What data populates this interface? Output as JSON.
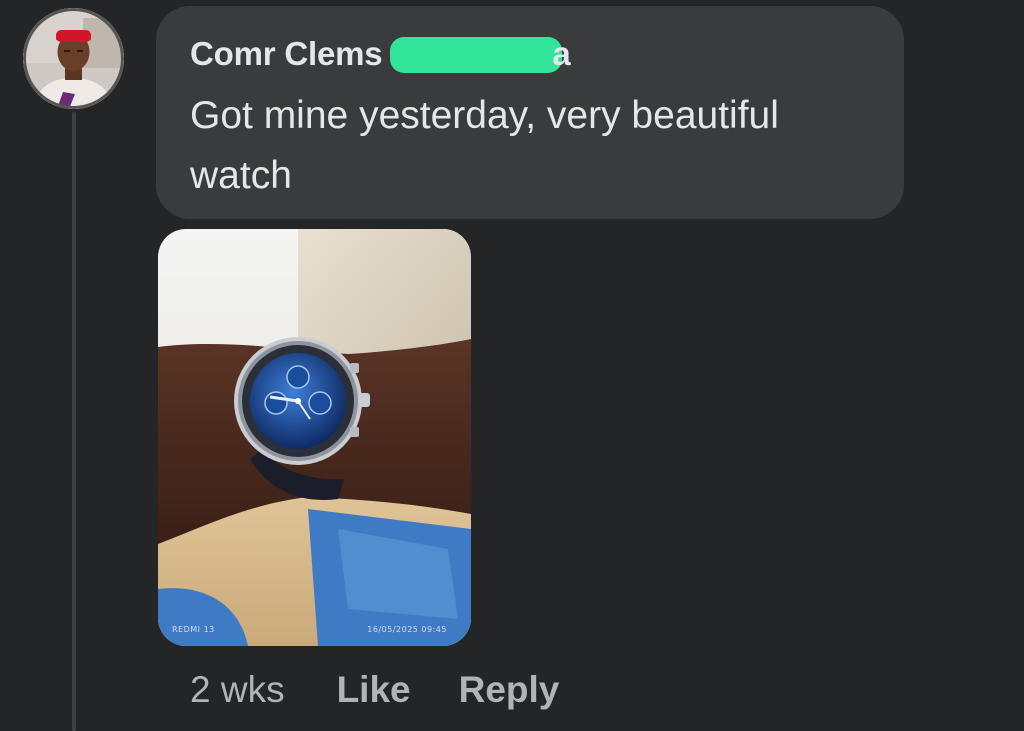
{
  "comment": {
    "author_name": "Comr Clems",
    "author_name_tail": "a",
    "text": "Got mine yesterday, very beautiful watch",
    "timestamp": "2 wks",
    "like_label": "Like",
    "reply_label": "Reply"
  },
  "photo": {
    "caption_left": "REDMI 13",
    "caption_right": "16/05/2025 09:45"
  },
  "colors": {
    "background": "#242526",
    "bubble": "#3a3b3c",
    "primary_text": "#e4e6eb",
    "secondary_text": "#b0b3b8",
    "redaction": "#33e59a"
  },
  "icons": {
    "avatar": "profile-photo",
    "photo": "wristwatch-photo"
  }
}
